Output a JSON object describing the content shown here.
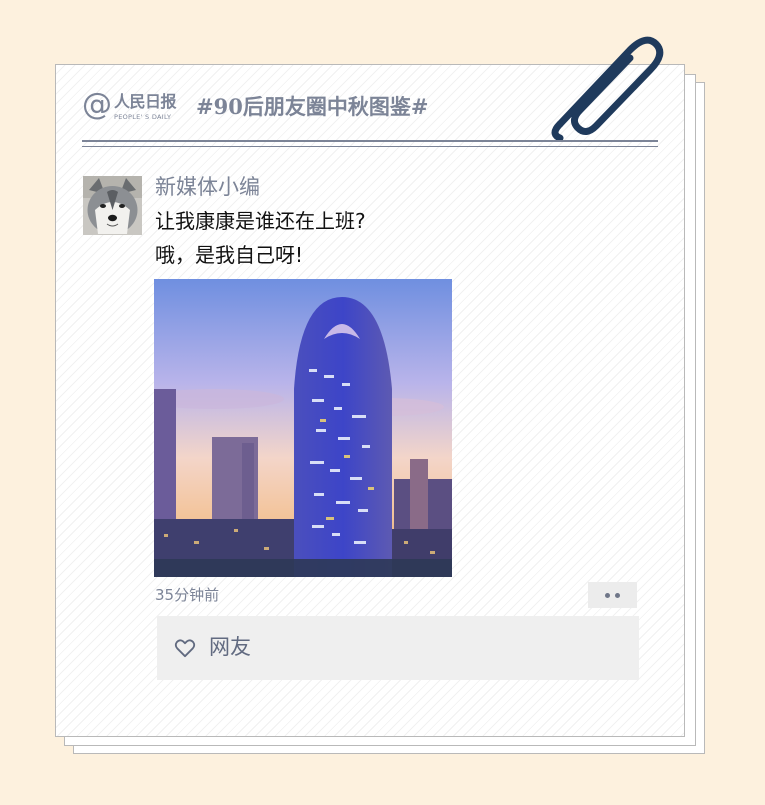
{
  "brand": {
    "logo_at": "@",
    "name_cn": "人民日报",
    "name_en": "PEOPLE' S DAILY"
  },
  "topic": {
    "hashtag": "#90后朋友圈中秋图鉴#"
  },
  "post": {
    "author": "新媒体小编",
    "text_lines": [
      "让我康康是谁还在上班?",
      "哦，是我自己呀!"
    ],
    "timestamp": "35分钟前",
    "likes": {
      "users": "网友"
    }
  },
  "colors": {
    "page_bg": "#fdf1de",
    "accent_gray_blue": "#7c8497",
    "paperclip": "#1f3a5c"
  },
  "icons": {
    "logo": "at-sign-icon",
    "clip": "paperclip-icon",
    "more": "more-dots-icon",
    "like": "heart-icon"
  }
}
